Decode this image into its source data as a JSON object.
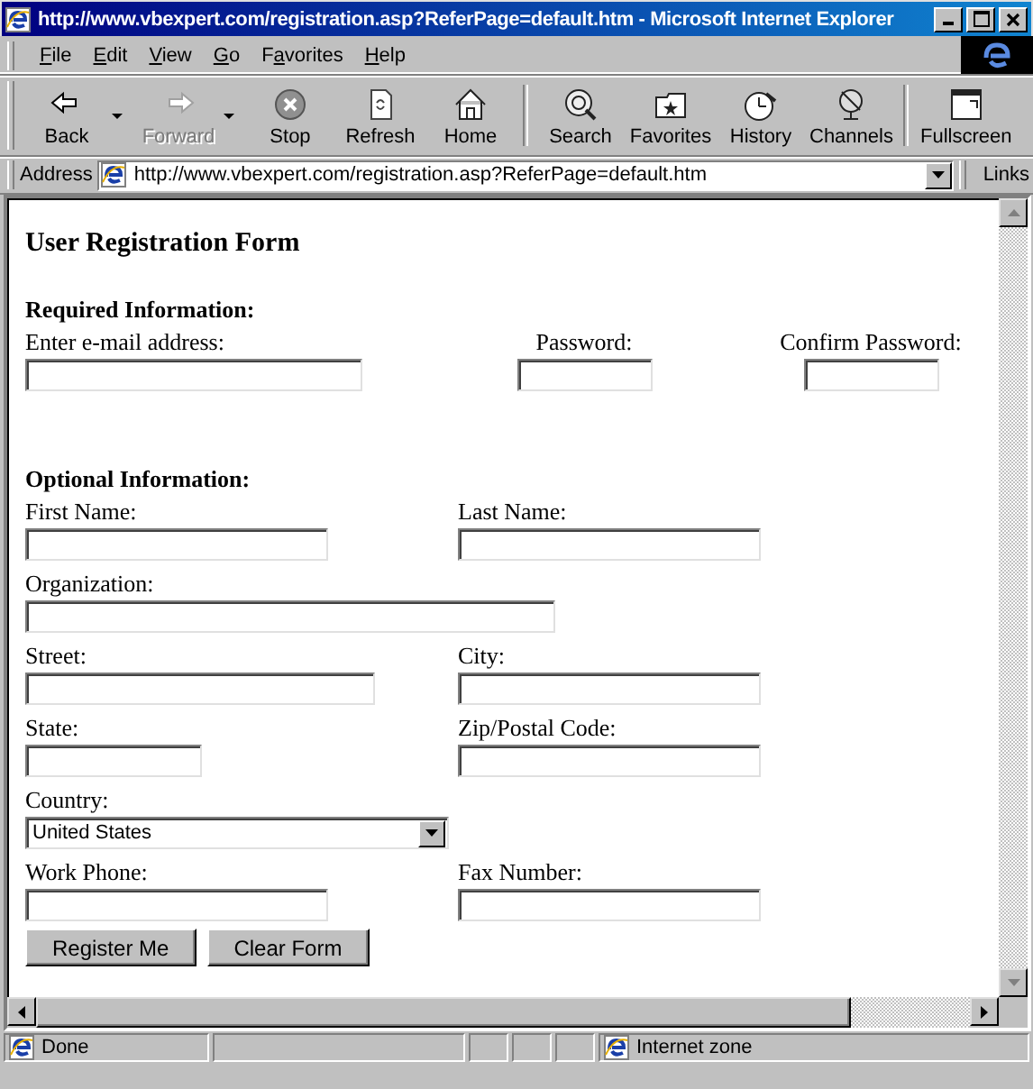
{
  "window": {
    "title": "http://www.vbexpert.com/registration.asp?ReferPage=default.htm - Microsoft Internet Explorer"
  },
  "menu": [
    {
      "key": "F",
      "after": "ile"
    },
    {
      "key": "E",
      "after": "dit"
    },
    {
      "key": "V",
      "after": "iew"
    },
    {
      "key": "G",
      "after": "o"
    },
    {
      "before": "F",
      "key": "a",
      "after": "vorites"
    },
    {
      "key": "H",
      "after": "elp"
    }
  ],
  "toolbar": [
    [
      {
        "label": "Back",
        "kind": "back",
        "disabled": false,
        "dropdown": true
      },
      {
        "label": "Forward",
        "kind": "forward",
        "disabled": true,
        "dropdown": true
      },
      {
        "label": "Stop",
        "kind": "stop",
        "disabled": false,
        "dropdown": false
      },
      {
        "label": "Refresh",
        "kind": "refresh",
        "disabled": false,
        "dropdown": false
      },
      {
        "label": "Home",
        "kind": "home",
        "disabled": false,
        "dropdown": false
      }
    ],
    [
      {
        "label": "Search",
        "kind": "search",
        "disabled": false,
        "dropdown": false
      },
      {
        "label": "Favorites",
        "kind": "favorites",
        "disabled": false,
        "dropdown": false
      },
      {
        "label": "History",
        "kind": "history",
        "disabled": false,
        "dropdown": false
      },
      {
        "label": "Channels",
        "kind": "channels",
        "disabled": false,
        "dropdown": false
      }
    ],
    [
      {
        "label": "Fullscreen",
        "kind": "fullscreen",
        "disabled": false,
        "dropdown": false
      }
    ]
  ],
  "address": {
    "label": "Address",
    "value": "http://www.vbexpert.com/registration.asp?ReferPage=default.htm",
    "links": "Links"
  },
  "page": {
    "heading": "User Registration Form",
    "required": {
      "title": "Required Information:",
      "fields": [
        {
          "label": "Enter e-mail address:",
          "kind": "text"
        },
        {
          "label": "Password:",
          "kind": "text"
        },
        {
          "label": "Confirm Password:",
          "kind": "text"
        }
      ]
    },
    "optional": {
      "title": "Optional Information:",
      "rows": [
        [
          {
            "label": "First Name:",
            "kind": "text"
          },
          {
            "label": "Last Name:",
            "kind": "text"
          }
        ],
        [
          {
            "label": "Organization:",
            "kind": "text"
          }
        ],
        [
          {
            "label": "Street:",
            "kind": "text"
          },
          {
            "label": "City:",
            "kind": "text"
          }
        ],
        [
          {
            "label": "State:",
            "kind": "text"
          },
          {
            "label": "Zip/Postal Code:",
            "kind": "text"
          }
        ],
        [
          {
            "label": "Country:",
            "kind": "select",
            "value": "United States"
          }
        ],
        [
          {
            "label": "Work Phone:",
            "kind": "text"
          },
          {
            "label": "Fax Number:",
            "kind": "text"
          }
        ]
      ]
    },
    "buttons": [
      "Register Me",
      "Clear Form"
    ]
  },
  "status_bar": {
    "text": "Done",
    "zone": "Internet zone"
  }
}
